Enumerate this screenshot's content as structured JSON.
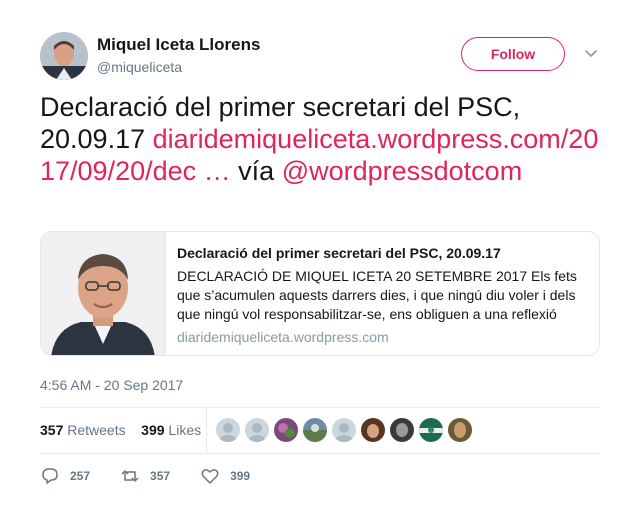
{
  "author": {
    "name": "Miquel Iceta Llorens",
    "handle": "@miqueliceta",
    "avatar_icon": "person-photo"
  },
  "follow_label": "Follow",
  "tweet": {
    "text_plain": "Declaració del primer secretari del PSC, 20.09.17",
    "link": "diaridemiqueliceta.wordpress.com/2017/09/20/dec",
    "ellipsis": " …",
    "via": " vía ",
    "mention": "@wordpressdotcom"
  },
  "card": {
    "title": "Declaració del primer secretari del PSC, 20.09.17",
    "description": "DECLARACIÓ DE MIQUEL ICETA 20 SETEMBRE 2017   Els fets que s’acumulen aquests darrers dies, i que ningú diu voler i dels que ningú vol responsabilitzar-se, ens obliguen a una reflexió",
    "url": "diaridemiqueliceta.wordpress.com"
  },
  "timestamp": "4:56 AM - 20 Sep 2017",
  "stats": {
    "retweets_count": "357",
    "retweets_label": "Retweets",
    "likes_count": "399",
    "likes_label": "Likes"
  },
  "actions": {
    "reply_count": "257",
    "retweet_count": "357",
    "like_count": "399"
  },
  "colors": {
    "accent": "#e0245e",
    "text": "#14171a",
    "secondary": "#657786"
  }
}
